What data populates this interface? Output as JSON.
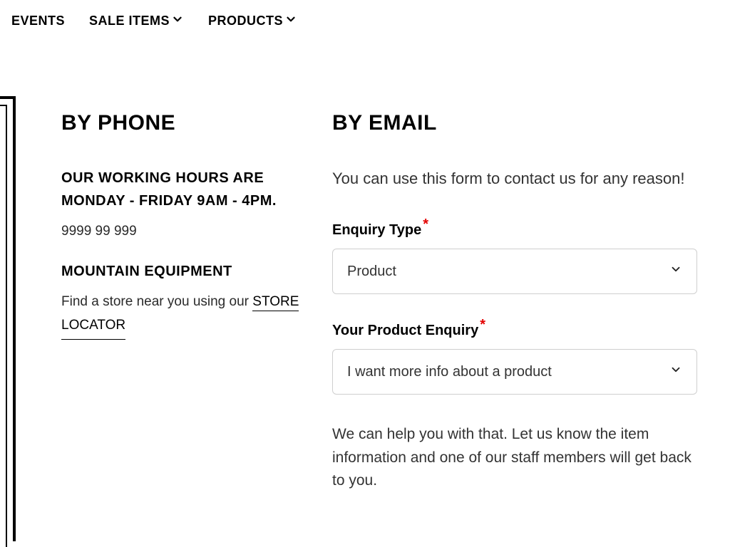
{
  "nav": {
    "events": "EVENTS",
    "sale": "SALE ITEMS",
    "products": "PRODUCTS"
  },
  "phone": {
    "title": "BY PHONE",
    "hours": "OUR WORKING HOURS ARE MONDAY - FRIDAY 9AM - 4PM.",
    "number": "9999 99 999",
    "brand": "MOUNTAIN EQUIPMENT",
    "store_pre": "Find a store near you using our ",
    "store_link_1": "STORE",
    "store_link_2": "LOCATOR"
  },
  "email": {
    "title": "BY EMAIL",
    "intro": "You can use this form to contact us for any reason!",
    "enquiry_label": "Enquiry Type",
    "enquiry_value": "Product",
    "product_label": "Your Product Enquiry",
    "product_value": "I want more info about a product",
    "help": "We can help you with that. Let us know the item information and one of our staff members will get back to you."
  }
}
